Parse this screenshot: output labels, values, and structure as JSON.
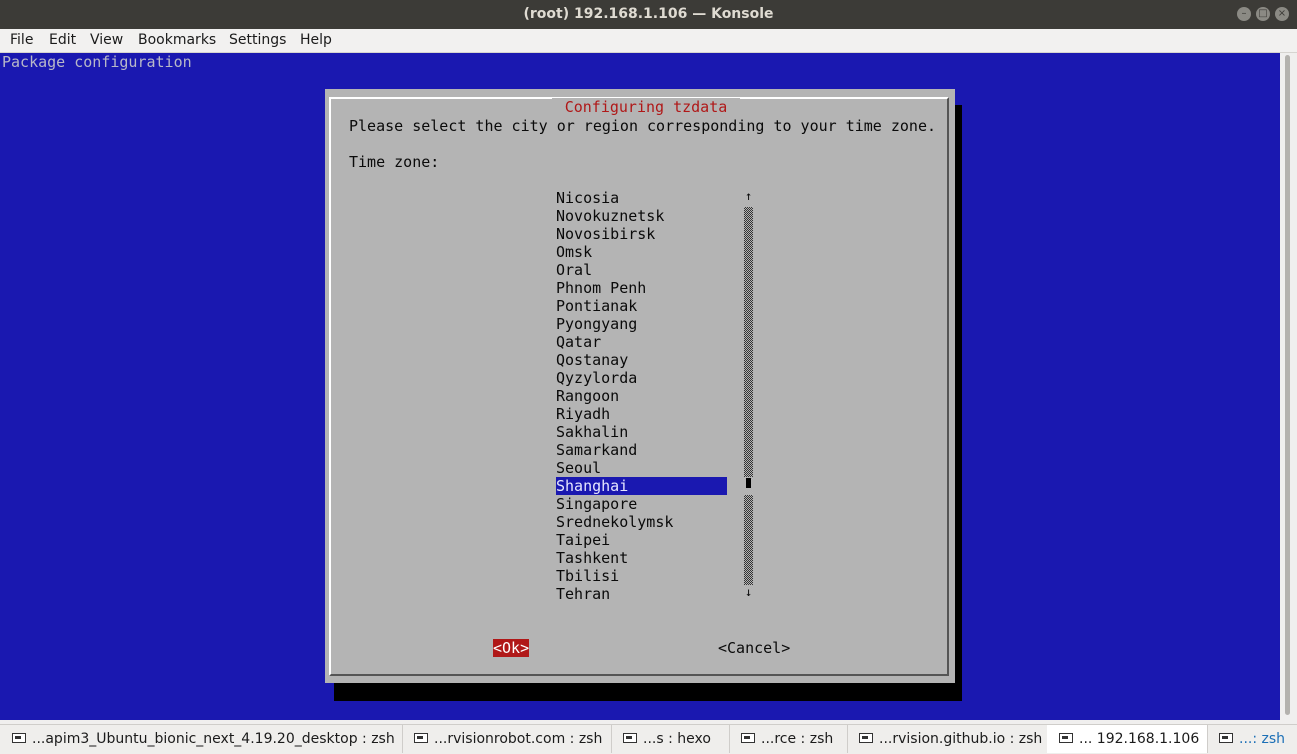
{
  "window": {
    "title": "(root) 192.168.1.106 — Konsole"
  },
  "menu": [
    "File",
    "Edit",
    "View",
    "Bookmarks",
    "Settings",
    "Help"
  ],
  "terminal": {
    "header": "Package configuration"
  },
  "dialog": {
    "title": " Configuring tzdata ",
    "prompt": "Please select the city or region corresponding to your time zone.",
    "field_label": "Time zone:",
    "options": [
      "Nicosia",
      "Novokuznetsk",
      "Novosibirsk",
      "Omsk",
      "Oral",
      "Phnom Penh",
      "Pontianak",
      "Pyongyang",
      "Qatar",
      "Qostanay",
      "Qyzylorda",
      "Rangoon",
      "Riyadh",
      "Sakhalin",
      "Samarkand",
      "Seoul",
      "Shanghai",
      "Singapore",
      "Srednekolymsk",
      "Taipei",
      "Tashkent",
      "Tbilisi",
      "Tehran"
    ],
    "selected": "Shanghai",
    "ok_label": "<Ok>",
    "cancel_label": "<Cancel>",
    "scroll_up": "↑",
    "scroll_down": "↓"
  },
  "tasks": [
    "...apim3_Ubuntu_bionic_next_4.19.20_desktop : zsh",
    "...rvisionrobot.com : zsh",
    "...s : hexo",
    "...rce : zsh",
    "...rvision.github.io : zsh",
    "... 192.168.1.106",
    "...: zsh"
  ],
  "active_task": "... 192.168.1.106",
  "colors": {
    "terminal_bg": "#1a18b0",
    "dialog_bg": "#b4b4b4",
    "accent_red": "#b01818"
  }
}
